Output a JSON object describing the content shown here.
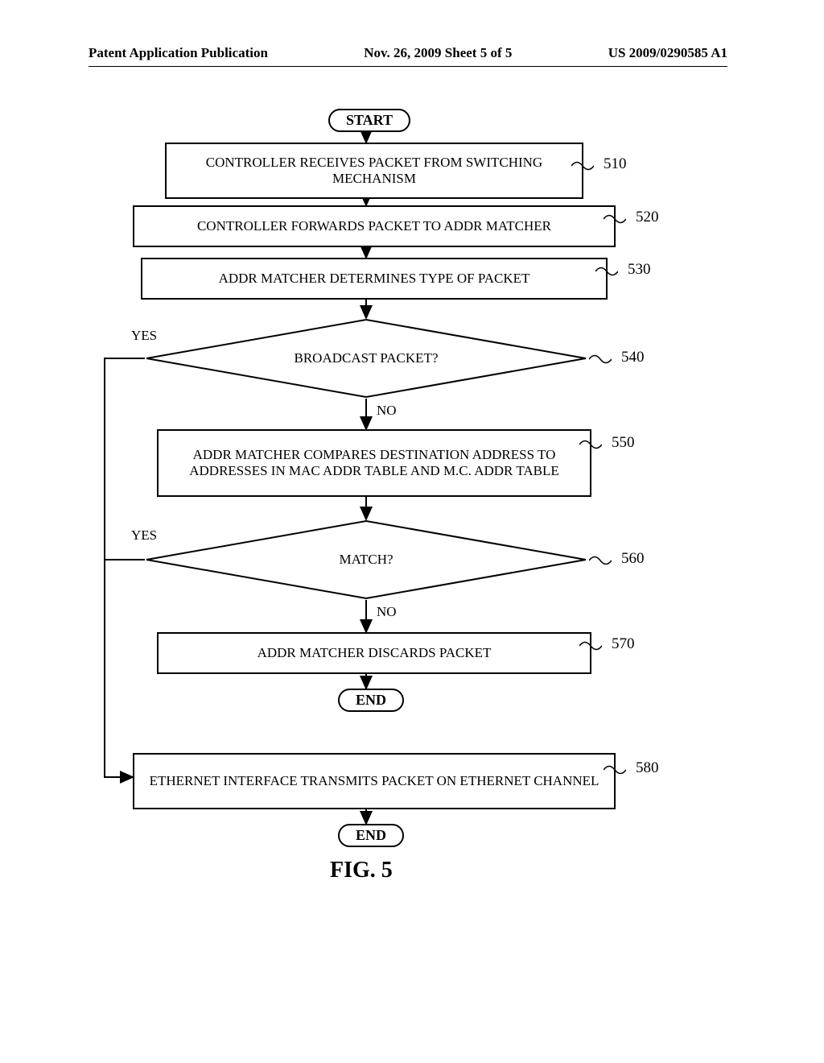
{
  "header": {
    "left": "Patent Application Publication",
    "center": "Nov. 26, 2009  Sheet 5 of 5",
    "right": "US 2009/0290585 A1"
  },
  "nodes": {
    "start": "START",
    "s510": "CONTROLLER RECEIVES PACKET FROM SWITCHING MECHANISM",
    "s520": "CONTROLLER FORWARDS PACKET TO ADDR MATCHER",
    "s530": "ADDR MATCHER DETERMINES TYPE OF PACKET",
    "d540": "BROADCAST PACKET?",
    "s550": "ADDR MATCHER COMPARES DESTINATION ADDRESS TO ADDRESSES IN MAC ADDR TABLE AND M.C. ADDR TABLE",
    "d560": "MATCH?",
    "s570": "ADDR MATCHER DISCARDS PACKET",
    "end1": "END",
    "s580": "ETHERNET INTERFACE TRANSMITS PACKET ON ETHERNET CHANNEL",
    "end2": "END"
  },
  "refs": {
    "r510": "510",
    "r520": "520",
    "r530": "530",
    "r540": "540",
    "r550": "550",
    "r560": "560",
    "r570": "570",
    "r580": "580"
  },
  "edges": {
    "yes540": "YES",
    "no540": "NO",
    "yes560": "YES",
    "no560": "NO"
  },
  "figure": "FIG. 5"
}
